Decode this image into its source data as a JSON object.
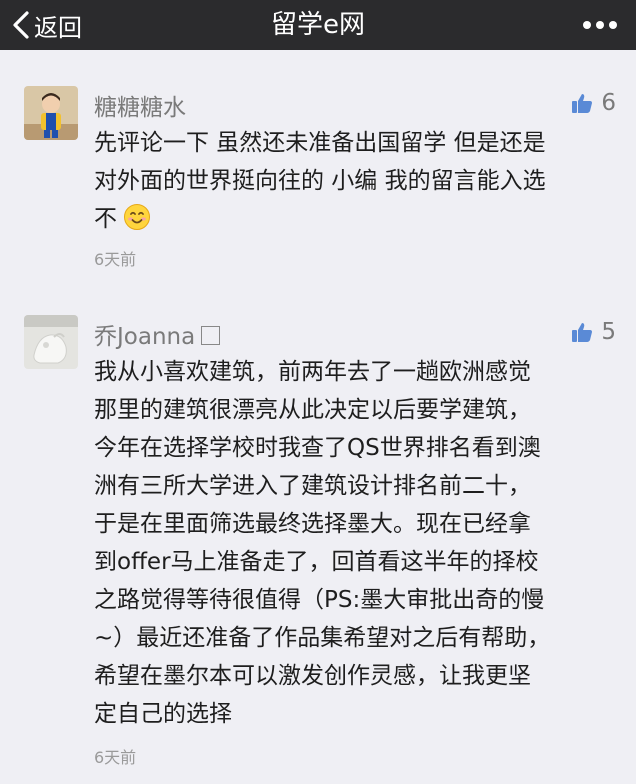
{
  "header": {
    "back_label": "返回",
    "title": "留学e网"
  },
  "comments": [
    {
      "name": "糖糖糖水",
      "likes": "6",
      "lines": [
        "先评论一下 虽然还未准备出国留学 但是还是",
        "对外面的世界挺向往的 小编 我的留言能入选",
        "不"
      ],
      "time": "6天前",
      "emoji": "smile-icon"
    },
    {
      "name": "乔Joanna",
      "likes": "5",
      "lines": [
        "我从小喜欢建筑，前两年去了一趟欧洲感觉",
        "那里的建筑很漂亮从此决定以后要学建筑，",
        "今年在选择学校时我查了QS世界排名看到澳",
        "洲有三所大学进入了建筑设计排名前二十，",
        "于是在里面筛选最终选择墨大。现在已经拿",
        "到offer马上准备走了，回首看这半年的择校",
        "之路觉得等待很值得（PS:墨大审批出奇的慢",
        "~）最近还准备了作品集希望对之后有帮助，",
        "希望在墨尔本可以激发创作灵感，让我更坚",
        "定自己的选择"
      ],
      "time": "6天前"
    }
  ],
  "colors": {
    "header_bg": "#2b2b2d",
    "page_bg": "#efeff4",
    "like_icon": "#5a8ad6"
  }
}
